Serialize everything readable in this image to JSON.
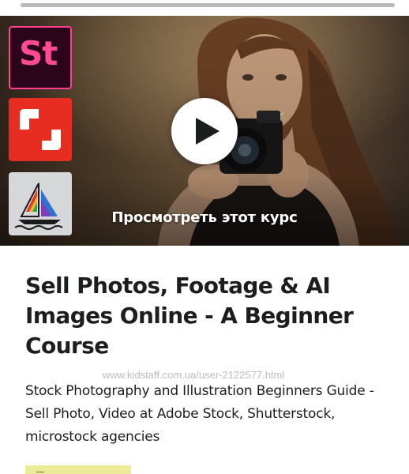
{
  "hero": {
    "preview_label": "Просмотреть этот курс",
    "icons": [
      "adobe-stock-icon",
      "shutterstock-icon",
      "sailboat-icon",
      "play-icon"
    ],
    "colors": {
      "stock_bg": "#2b0519",
      "stock_accent": "#ff3f8f",
      "shutterstock_red": "#e72c22",
      "play_button": "#ffffff"
    }
  },
  "app_icons": {
    "stock_label": "St"
  },
  "course": {
    "title": "Sell Photos, Footage & AI Images Online - A Beginner Course",
    "subtitle": "Stock Photography and Illustration Beginners Guide - Sell Photo, Video at Adobe Stock, Shutterstock, microstock agencies"
  },
  "watermark": {
    "text": "www.kidstaff.com.ua/user-2122577.html"
  },
  "badge": {
    "color": "#eceb98"
  }
}
